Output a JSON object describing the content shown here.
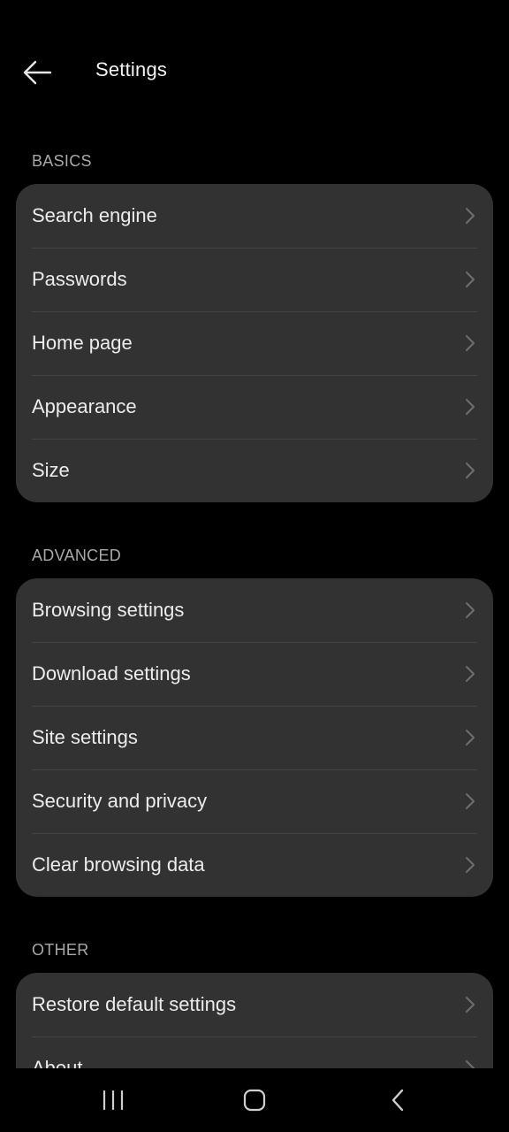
{
  "header": {
    "title": "Settings",
    "back_icon": "arrow-left-icon"
  },
  "sections": [
    {
      "title": "BASICS",
      "items": [
        {
          "label": "Search engine"
        },
        {
          "label": "Passwords"
        },
        {
          "label": "Home page"
        },
        {
          "label": "Appearance"
        },
        {
          "label": "Size"
        }
      ]
    },
    {
      "title": "ADVANCED",
      "items": [
        {
          "label": "Browsing settings"
        },
        {
          "label": "Download settings"
        },
        {
          "label": "Site settings"
        },
        {
          "label": "Security and privacy"
        },
        {
          "label": "Clear browsing data"
        }
      ]
    },
    {
      "title": "OTHER",
      "items": [
        {
          "label": "Restore default settings"
        },
        {
          "label": "About"
        }
      ]
    }
  ],
  "navbar": {
    "recents_icon": "recents-icon",
    "home_icon": "home-icon",
    "back_icon": "back-icon"
  },
  "colors": {
    "background": "#000000",
    "card": "#323232",
    "divider": "#444444",
    "text": "#ececec",
    "section_header": "#a8a8a8",
    "chevron": "#6e6e6e"
  }
}
